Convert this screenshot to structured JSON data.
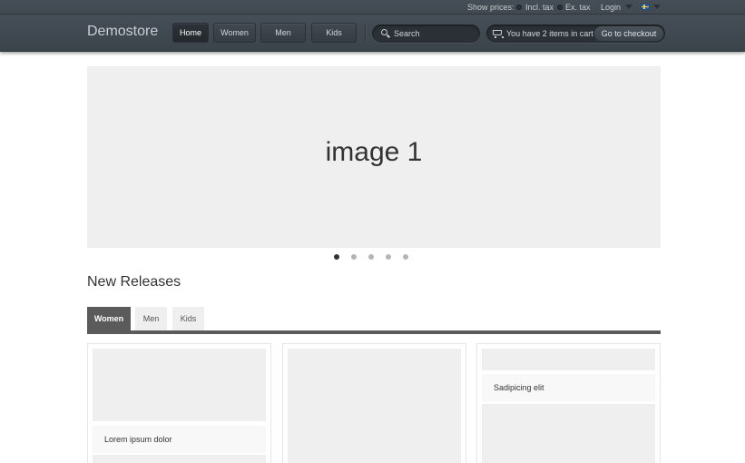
{
  "header": {
    "utility": {
      "show_prices_label": "Show prices:",
      "incl_tax_label": "Incl. tax",
      "ex_tax_label": "Ex. tax",
      "login_label": "Login",
      "flag_icon": "swedish-flag-icon"
    },
    "brand": "Demostore",
    "nav": [
      {
        "label": "Home",
        "active": true
      },
      {
        "label": "Women",
        "active": false
      },
      {
        "label": "Men",
        "active": false
      },
      {
        "label": "Kids",
        "active": false
      }
    ],
    "search": {
      "placeholder": "Search",
      "value": "",
      "icon": "search-icon"
    },
    "cart": {
      "text": "You have 2 items in cart",
      "checkout_label": "Go to checkout",
      "icon": "cart-icon"
    }
  },
  "slider": {
    "label": "image 1",
    "slide_count": 5,
    "active_index": 0
  },
  "section": {
    "title": "New Releases",
    "tabs": [
      {
        "label": "Women",
        "active": true
      },
      {
        "label": "Men",
        "active": false
      },
      {
        "label": "Kids",
        "active": false
      }
    ]
  },
  "products": [
    {
      "caption": "Lorem ipsum dolor"
    },
    {
      "caption": ""
    },
    {
      "caption": "Sadipicing elit"
    }
  ],
  "colors": {
    "header_bg": "#434b53",
    "active_tab": "#5b5b5b",
    "placeholder": "#efefef",
    "active_dot": "#333333"
  }
}
